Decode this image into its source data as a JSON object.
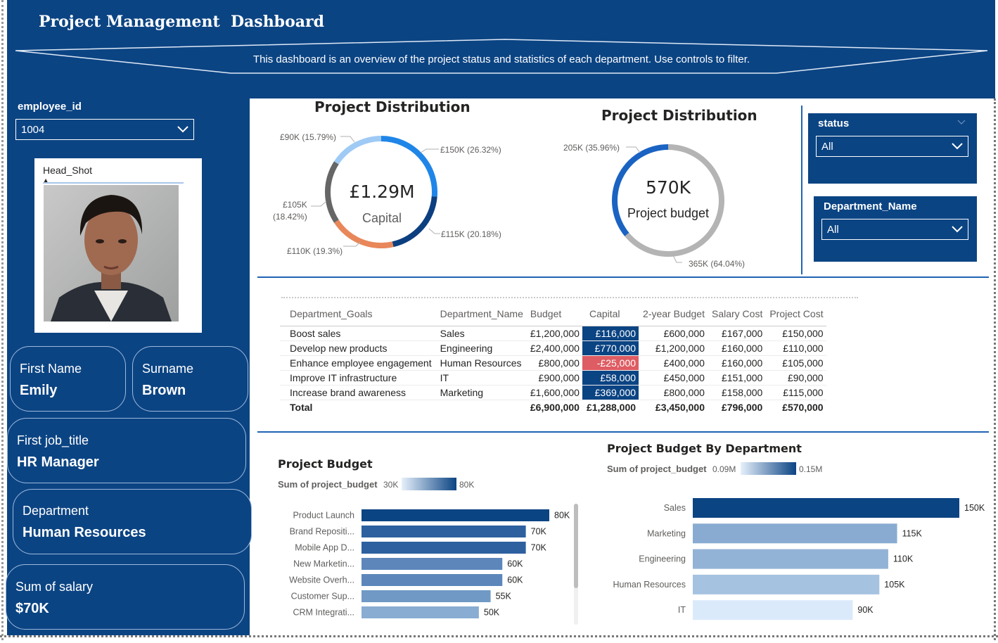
{
  "header": {
    "title": "Project Management  Dashboard",
    "subtitle": "This dashboard is an overview of the project status and statistics of each department. Use controls to filter."
  },
  "employee": {
    "filter_label": "employee_id",
    "filter_value": "1004",
    "headshot_label": "Head_Shot",
    "first_name_label": "First Name",
    "first_name": "Emily",
    "surname_label": "Surname",
    "surname": "Brown",
    "job_label": "First job_title",
    "job": "HR Manager",
    "department_label": "Department",
    "department": "Human Resources",
    "salary_label": "Sum of salary",
    "salary": "$70K"
  },
  "slicers": {
    "status_label": "status",
    "status_value": "All",
    "department_label": "Department_Name",
    "department_value": "All"
  },
  "capital_donut": {
    "title": "Project Distribution",
    "center_value": "£1.29M",
    "center_label": "Capital",
    "labels": [
      "£90K (15.79%)",
      "£150K (26.32%)",
      "£105K",
      "(18.42%)",
      "£115K (20.18%)",
      "£110K (19.3%)"
    ],
    "colors": {
      "light_blue": "#9fcaf5",
      "blue": "#1f86e8",
      "navy": "#0c3f80",
      "orange": "#e8875a",
      "gray": "#666666"
    }
  },
  "budget_donut": {
    "title": "Project Distribution",
    "center_value": "570K",
    "center_label": "Project budget",
    "labels": [
      "205K (35.96%)",
      "365K (64.04%)"
    ],
    "colors": {
      "budget": "#1a63c2",
      "rest": "#b4b4b4"
    }
  },
  "table": {
    "headers": [
      "Department_Goals",
      "Department_Name",
      "Budget",
      "Capital",
      "2-year Budget",
      "Salary Cost",
      "Project Cost"
    ],
    "rows": [
      [
        "Boost sales",
        "Sales",
        "£1,200,000",
        "£116,000",
        "£600,000",
        "£167,000",
        "£150,000"
      ],
      [
        "Develop new products",
        "Engineering",
        "£2,400,000",
        "£770,000",
        "£1,200,000",
        "£160,000",
        "£110,000"
      ],
      [
        "Enhance employee engagement",
        "Human Resources",
        "£800,000",
        "-£25,000",
        "£400,000",
        "£160,000",
        "£105,000"
      ],
      [
        "Improve IT infrastructure",
        "IT",
        "£900,000",
        "£58,000",
        "£450,000",
        "£151,000",
        "£90,000"
      ],
      [
        "Increase brand awareness",
        "Marketing",
        "£1,600,000",
        "£369,000",
        "£800,000",
        "£158,000",
        "£115,000"
      ]
    ],
    "total": [
      "Total",
      "",
      "£6,900,000",
      "£1,288,000",
      "£3,450,000",
      "£796,000",
      "£570,000"
    ],
    "capital_colors": [
      "#0b4483",
      "#0b4483",
      "#de5c63",
      "#0b4483",
      "#0b4483"
    ]
  },
  "chart_data": [
    {
      "type": "bar",
      "title": "Project Budget",
      "legend_label": "Sum of project_budget",
      "legend_min": "30K",
      "legend_max": "80K",
      "categories": [
        "Product Launch",
        "Brand Repositi...",
        "Mobile App D...",
        "New Marketin...",
        "Website Overh...",
        "Customer Sup...",
        "CRM Integrati..."
      ],
      "values": [
        80,
        70,
        70,
        60,
        60,
        55,
        50
      ],
      "value_labels": [
        "80K",
        "70K",
        "70K",
        "60K",
        "60K",
        "55K",
        "50K"
      ],
      "colors": [
        "#0b4483",
        "#2d609f",
        "#2d609f",
        "#5d87bb",
        "#5d87bb",
        "#7099c6",
        "#89acd2"
      ]
    },
    {
      "type": "bar",
      "title": "Project Budget By Department",
      "legend_label": "Sum of project_budget",
      "legend_min": "0.09M",
      "legend_max": "0.15M",
      "categories": [
        "Sales",
        "Marketing",
        "Engineering",
        "Human Resources",
        "IT"
      ],
      "values": [
        150,
        115,
        110,
        105,
        90
      ],
      "value_labels": [
        "150K",
        "115K",
        "110K",
        "105K",
        "90K"
      ],
      "colors": [
        "#0b4483",
        "#89abd1",
        "#93b3d6",
        "#a6c2e1",
        "#dbeafb"
      ]
    }
  ]
}
